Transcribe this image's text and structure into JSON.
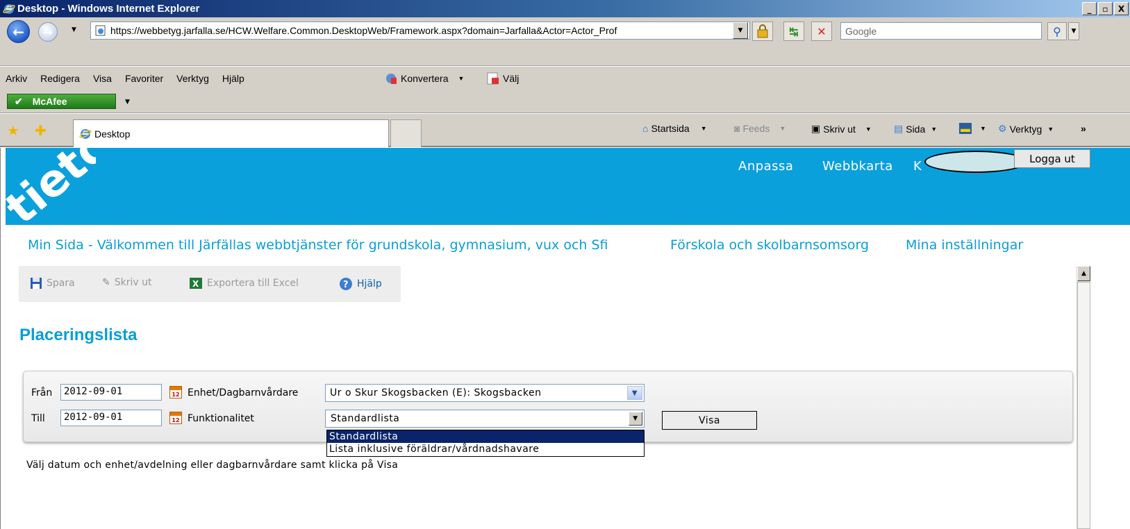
{
  "window": {
    "title": "Desktop - Windows Internet Explorer",
    "minimize": "_",
    "maximize": "▫",
    "close": "X"
  },
  "addressbar": {
    "url": "https://webbetyg.jarfalla.se/HCW.Welfare.Common.DesktopWeb/Framework.aspx?domain=Jarfalla&Actor=Actor_Prof",
    "search_placeholder": "Google"
  },
  "menu": {
    "items": [
      "Arkiv",
      "Redigera",
      "Visa",
      "Favoriter",
      "Verktyg",
      "Hjälp"
    ],
    "konvertera": "Konvertera",
    "valj": "Välj"
  },
  "mcafee": {
    "label": "McAfee"
  },
  "tabs": {
    "active_tab": "Desktop"
  },
  "commandbar": {
    "startsida": "Startsida",
    "feeds": "Feeds",
    "skriv_ut": "Skriv ut",
    "sida": "Sida",
    "verktyg": "Verktyg",
    "more": "»"
  },
  "header": {
    "anpassa": "Anpassa",
    "webbkarta": "Webbkarta",
    "user_initial": "K",
    "logout": "Logga ut",
    "brand_color": "#0aa0dc"
  },
  "mainnav": {
    "items": [
      "Min Sida - Välkommen till Järfällas webbtjänster för grundskola, gymnasium, vux och Sfi",
      "Förskola och skolbarnsomsorg",
      "Mina inställningar"
    ]
  },
  "toolbar": {
    "spara": "Spara",
    "skriv_ut": "Skriv ut",
    "exportera": "Exportera till Excel",
    "hjalp": "Hjälp"
  },
  "page": {
    "title": "Placeringslista",
    "hint": "Välj datum och enhet/avdelning eller dagbarnvårdare samt klicka på Visa"
  },
  "filter": {
    "fran_label": "Från",
    "fran_value": "2012-09-01",
    "till_label": "Till",
    "till_value": "2012-09-01",
    "enhet_label": "Enhet/Dagbarnvårdare",
    "enhet_value": "Ur o Skur Skogsbacken (E): Skogsbacken",
    "funktion_label": "Funktionalitet",
    "funktion_value": "Standardlista",
    "visa_button": "Visa",
    "funktion_options": [
      "Standardlista",
      "Lista inklusive föräldrar/vårdnadshavare"
    ],
    "calendar_day": "12"
  }
}
